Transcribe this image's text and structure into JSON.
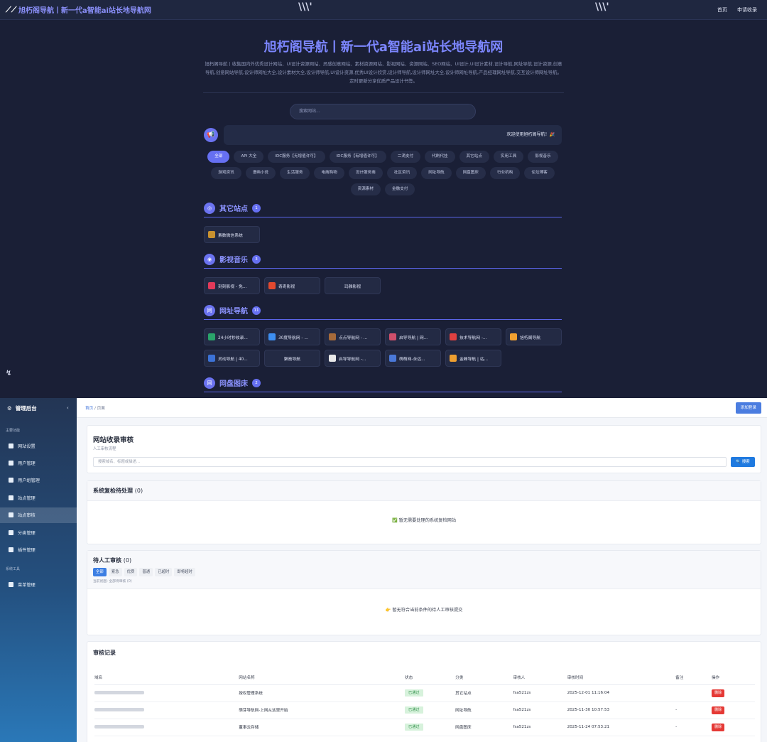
{
  "front": {
    "brand": "旭朽阁导航丨新一代a智能ai站长地导航网",
    "nav": [
      "首页",
      "申请收录"
    ],
    "hero_title": "旭朽阁导航丨新一代a智能ai站长地导航网",
    "hero_desc": "旭朽阁导航丨收集国内外优秀设计网站、UI设计资源网站、灵感创意网站、素材资源网站、影视网站、资源网站、SEO网站、UI设计,UI设计素材,设计导航,网址导航,设计资源,创意导航,创意网站导航,设计师网址大全,设计素材大全,设计师导航,UI设计资源,优秀UI设计欣赏,设计师导航,设计师网址大全,设计师网址导航,产品经理网址导航,交互设计师网址导航。 定时更新分享优质产品设计书签。",
    "search_placeholder": "搜索网站...",
    "notice": "欢迎使用旭朽阁导航！🎉",
    "tags": [
      "全部",
      "API 大全",
      "IDC服务【无增值许可】",
      "IDC服务【有增值许可】",
      "二滴支付",
      "代刷代挂",
      "其它站点",
      "实用工具",
      "影视音乐",
      "游戏资讯",
      "漫画小说",
      "生活服务",
      "电商购物",
      "设计服务商",
      "社区资讯",
      "网址导航",
      "网盘图床",
      "行业机构",
      "论坛博客",
      "资源素材",
      "金融支付"
    ],
    "sections": [
      {
        "title": "其它站点",
        "count": "1",
        "cards": [
          {
            "name": "素数微信系统",
            "color": "#c8912f"
          }
        ]
      },
      {
        "title": "影视音乐",
        "count": "3",
        "cards": [
          {
            "name": "刻刻影视 - 免...",
            "color": "#e23a5a"
          },
          {
            "name": "奇奇影视",
            "color": "#e2492f"
          },
          {
            "name": "玛雅影视",
            "color": ""
          }
        ]
      },
      {
        "title": "网址导航",
        "count": "11",
        "cards": [
          {
            "name": "24小时秒收录...",
            "color": "#2aa36a"
          },
          {
            "name": "30度导航网 - ...",
            "color": "#3d8ef0"
          },
          {
            "name": "点点导航网 - ...",
            "color": "#a66a3a"
          },
          {
            "name": "启导导航 | 网...",
            "color": "#d04f6b"
          },
          {
            "name": "技术导航网 -...",
            "color": "#e04040"
          },
          {
            "name": "旭朽阁导航",
            "color": "#f0a030"
          },
          {
            "name": "灵动导航 | 40...",
            "color": "#3c72d6"
          },
          {
            "name": "聚筋导航",
            "color": ""
          },
          {
            "name": "启导导航网 -...",
            "color": "#e8e8e8"
          },
          {
            "name": "萌萌网-永远...",
            "color": "#4a78d8"
          },
          {
            "name": "金蝉导航 | 站...",
            "color": "#f0a030"
          }
        ]
      },
      {
        "title": "网盘图床",
        "count": "2",
        "cards": []
      }
    ]
  },
  "admin": {
    "sidebar_title": "管理后台",
    "group_main": "主要功能",
    "menu": [
      "网站设置",
      "用户管理",
      "用户组管理",
      "站点管理",
      "站点审核",
      "分类管理",
      "插件管理"
    ],
    "group_system": "系统工具",
    "menu_system": [
      "菜单管理"
    ],
    "active_index": 4,
    "breadcrumb_home": "首页",
    "breadcrumb_sep": " / ",
    "breadcrumb_current": "页面",
    "add_button": "添加登录",
    "review": {
      "title": "网站收录审核",
      "subtitle": "人工审核流程",
      "search_placeholder": "搜索域名、标题或描述...",
      "search_button": "🔍 搜索"
    },
    "system_panel": {
      "title": "系统复检待处理",
      "count": "(0)",
      "empty": "✅ 暂无需要处理的系统复检网站"
    },
    "manual_panel": {
      "title": "待人工审核",
      "count": "(0)",
      "filters": [
        "全部",
        "紧急",
        "优质",
        "普通",
        "已超时",
        "即将超时"
      ],
      "current_view": "当前视图: 全部待审核 (0)",
      "empty": "👉 暂无符合当前条件的待人工审核提交"
    },
    "records": {
      "title": "审核记录",
      "columns": [
        "域名",
        "网站名称",
        "状态",
        "分类",
        "审核人",
        "审核时间",
        "备注",
        "操作"
      ],
      "rows": [
        {
          "name": "授权管理系统",
          "status": "已通过",
          "category": "其它站点",
          "reviewer": "fsa521zs",
          "time": "2025-12-01 11:16:04",
          "note": "",
          "action": "删除"
        },
        {
          "name": "萌芽导航网-上网从这里开始",
          "status": "已通过",
          "category": "网址导航",
          "reviewer": "fsa521zs",
          "time": "2025-11-30 10:57:53",
          "note": "-",
          "action": "删除"
        },
        {
          "name": "董事云存储",
          "status": "已通过",
          "category": "网盘图床",
          "reviewer": "fsa521zs",
          "time": "2025-11-24 07:53:21",
          "note": "-",
          "action": "删除"
        }
      ]
    }
  }
}
